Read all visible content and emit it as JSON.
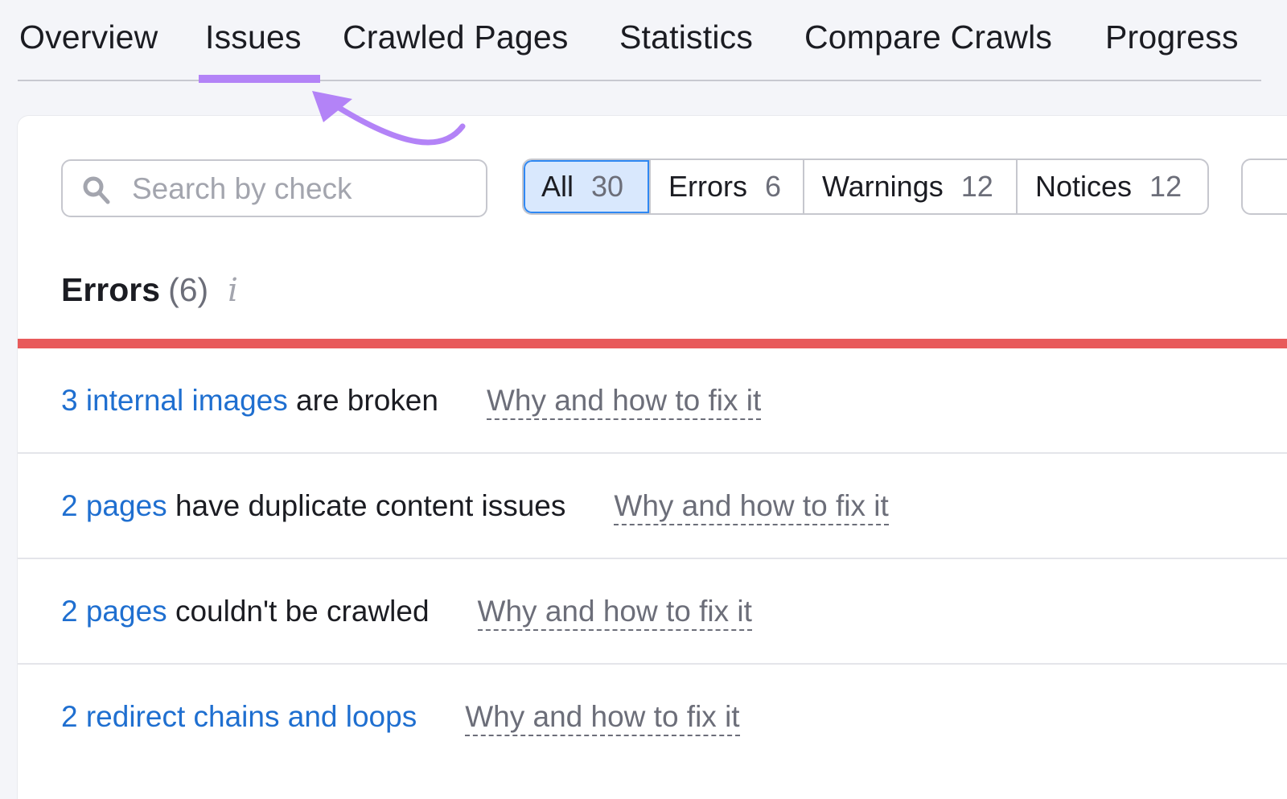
{
  "tabs": [
    {
      "label": "Overview",
      "active": false
    },
    {
      "label": "Issues",
      "active": true
    },
    {
      "label": "Crawled Pages",
      "active": false
    },
    {
      "label": "Statistics",
      "active": false
    },
    {
      "label": "Compare Crawls",
      "active": false
    },
    {
      "label": "Progress",
      "active": false
    }
  ],
  "annotation": {
    "icon": "curved-arrow-icon",
    "color": "#b383f7"
  },
  "search": {
    "placeholder": "Search by check",
    "value": "",
    "icon": "search-icon"
  },
  "filters": [
    {
      "label": "All",
      "count": "30",
      "active": true
    },
    {
      "label": "Errors",
      "count": "6",
      "active": false
    },
    {
      "label": "Warnings",
      "count": "12",
      "active": false
    },
    {
      "label": "Notices",
      "count": "12",
      "active": false
    }
  ],
  "section": {
    "title": "Errors",
    "count": "(6)",
    "info_icon": "info-icon",
    "info_glyph": "i",
    "accent": "#e85a5b"
  },
  "issues": [
    {
      "link": "3 internal images",
      "rest": " are broken",
      "why": "Why and how to fix it"
    },
    {
      "link": "2 pages",
      "rest": " have duplicate content issues",
      "why": "Why and how to fix it"
    },
    {
      "link": "2 pages",
      "rest": " couldn't be crawled",
      "why": "Why and how to fix it"
    },
    {
      "link": "2 redirect chains and loops",
      "rest": "",
      "why": "Why and how to fix it"
    }
  ],
  "colors": {
    "link": "#1f6fd0",
    "active_tab": "#b383f7",
    "active_filter_bg": "#d9e8fd",
    "active_filter_border": "#2f88f3",
    "error": "#e85a5b"
  }
}
